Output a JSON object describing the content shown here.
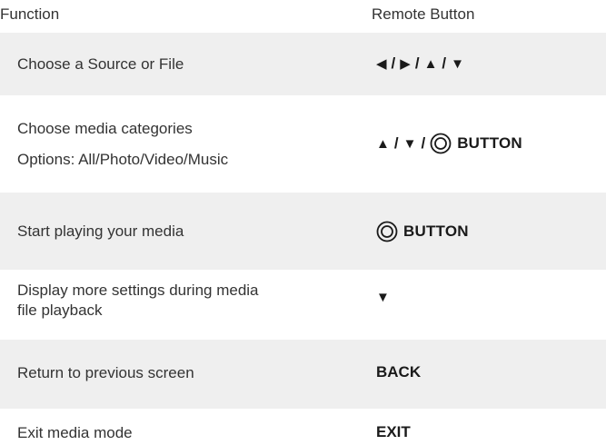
{
  "header": {
    "function_label": "Function",
    "remote_button_label": "Remote Button"
  },
  "rows": [
    {
      "function": [
        "Choose a Source or File"
      ],
      "button": {
        "symbols": [
          "◀",
          "▶",
          "▲",
          "▼"
        ],
        "separator": "/"
      }
    },
    {
      "function": [
        "Choose media categories",
        "Options: All/Photo/Video/Music"
      ],
      "button": {
        "symbols": [
          "▲",
          "▼"
        ],
        "separator": "/",
        "ok_icon": "ok-button-icon",
        "label": "BUTTON"
      }
    },
    {
      "function": [
        "Start playing your media"
      ],
      "button": {
        "ok_icon": "ok-button-icon",
        "label": "BUTTON"
      }
    },
    {
      "function": [
        "Display more settings during media",
        "file playback"
      ],
      "button": {
        "symbols": [
          "▼"
        ]
      }
    },
    {
      "function": [
        "Return to previous screen"
      ],
      "button": {
        "label": "BACK"
      }
    },
    {
      "function": [
        "Exit media mode"
      ],
      "button": {
        "label": "EXIT"
      }
    }
  ],
  "colors": {
    "shaded_row": "#efefef",
    "text": "#333333",
    "button_text": "#1a1a1a"
  }
}
